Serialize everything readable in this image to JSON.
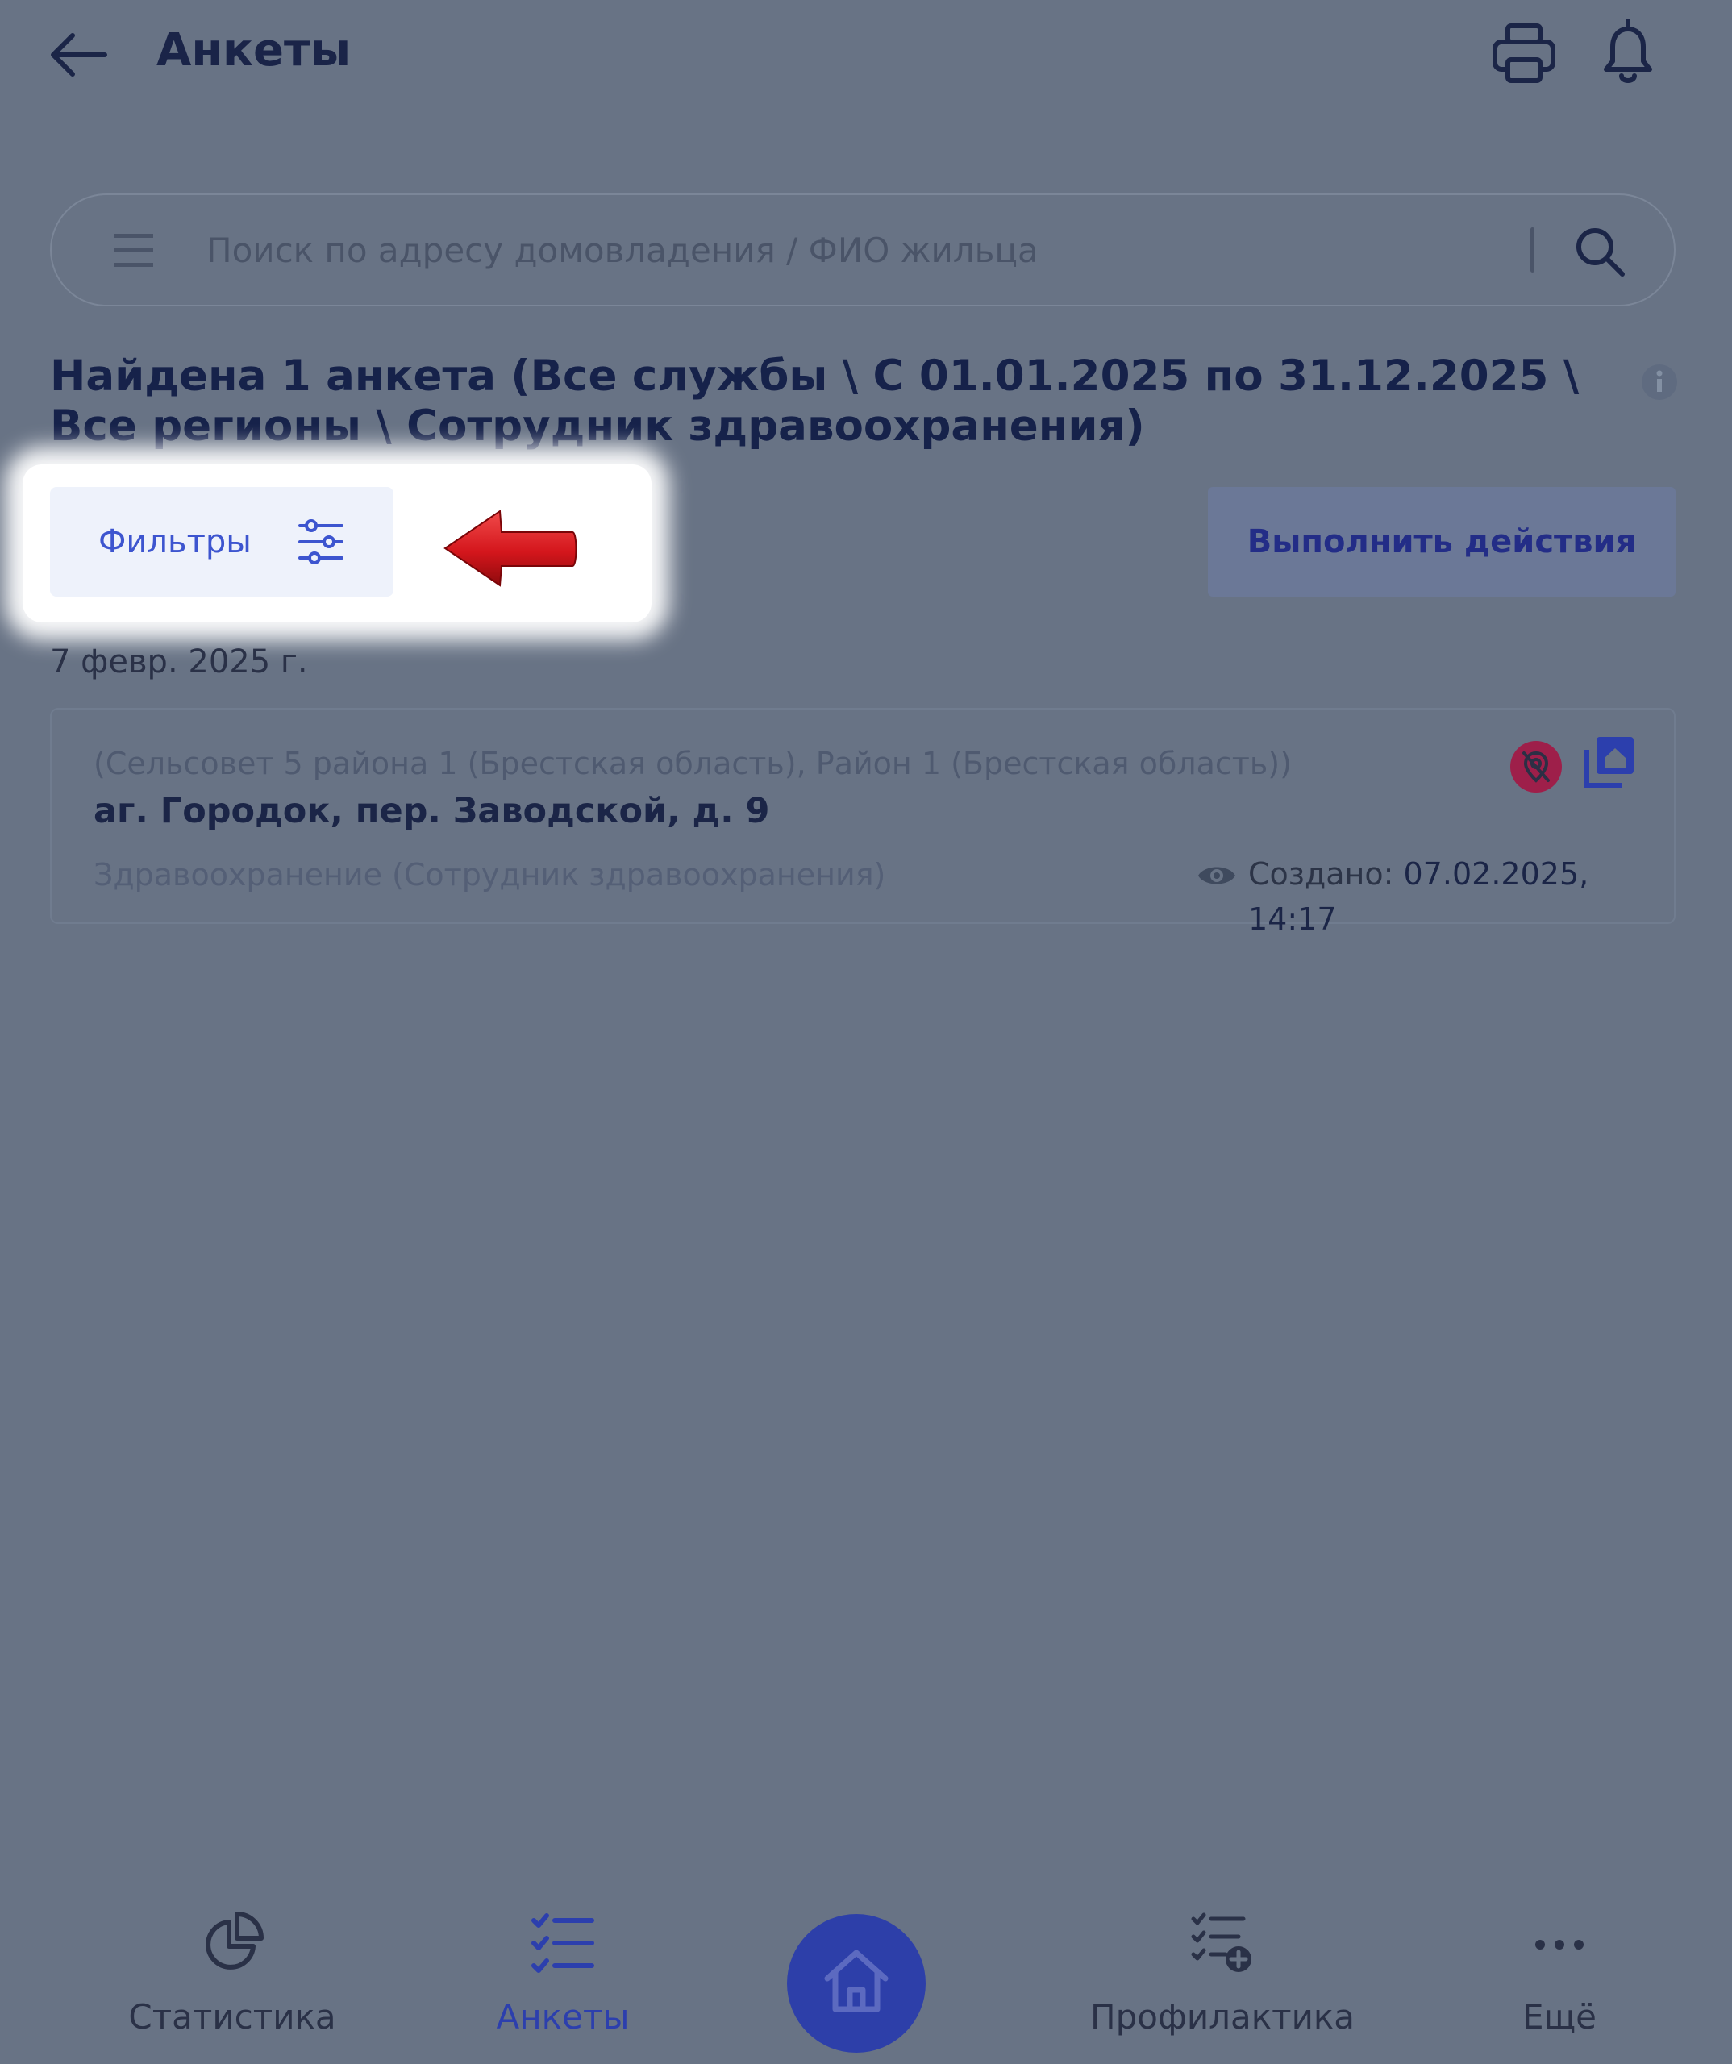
{
  "header": {
    "title": "Анкеты",
    "back_icon": "arrow-left-icon",
    "print_icon": "printer-icon",
    "bell_icon": "bell-icon"
  },
  "search": {
    "placeholder": "Поиск по адресу домовладения / ФИО жильца",
    "menu_icon": "hamburger-icon",
    "search_icon": "magnifier-icon"
  },
  "results": {
    "summary": "Найдена 1 анкета (Все службы \\ С 01.01.2025 по 31.12.2025 \\ Все регионы \\ Сотрудник здравоохранения)",
    "info_icon": "info-icon"
  },
  "toolbar": {
    "filters_label": "Фильтры",
    "filters_icon": "sliders-icon",
    "actions_label": "Выполнить действия"
  },
  "list": {
    "date_group": "7 февр. 2025 г.",
    "items": [
      {
        "area": "(Сельсовет 5 района 1 (Брестская область), Район 1 (Брестская область))",
        "address": "аг. Городок, пер. Заводской, д. 9",
        "service": "Здравоохранение (Сотрудник здравоохранения)",
        "created_label": "Создано:",
        "created_value": "07.02.2025, 14:17"
      }
    ]
  },
  "nav": {
    "items": [
      {
        "label": "Статистика",
        "icon": "pie-chart-icon"
      },
      {
        "label": "Анкеты",
        "icon": "checklist-icon",
        "active": true
      },
      {
        "label": "",
        "icon": "home-icon"
      },
      {
        "label": "Профилактика",
        "icon": "checklist-add-icon"
      },
      {
        "label": "Ещё",
        "icon": "more-dots-icon"
      }
    ]
  },
  "colors": {
    "overlay_bg": "#687385",
    "accent": "#3d55cf",
    "home_button": "#2d3fa9",
    "arrow": "#d4161c",
    "geo_badge": "#9e1f4a"
  }
}
